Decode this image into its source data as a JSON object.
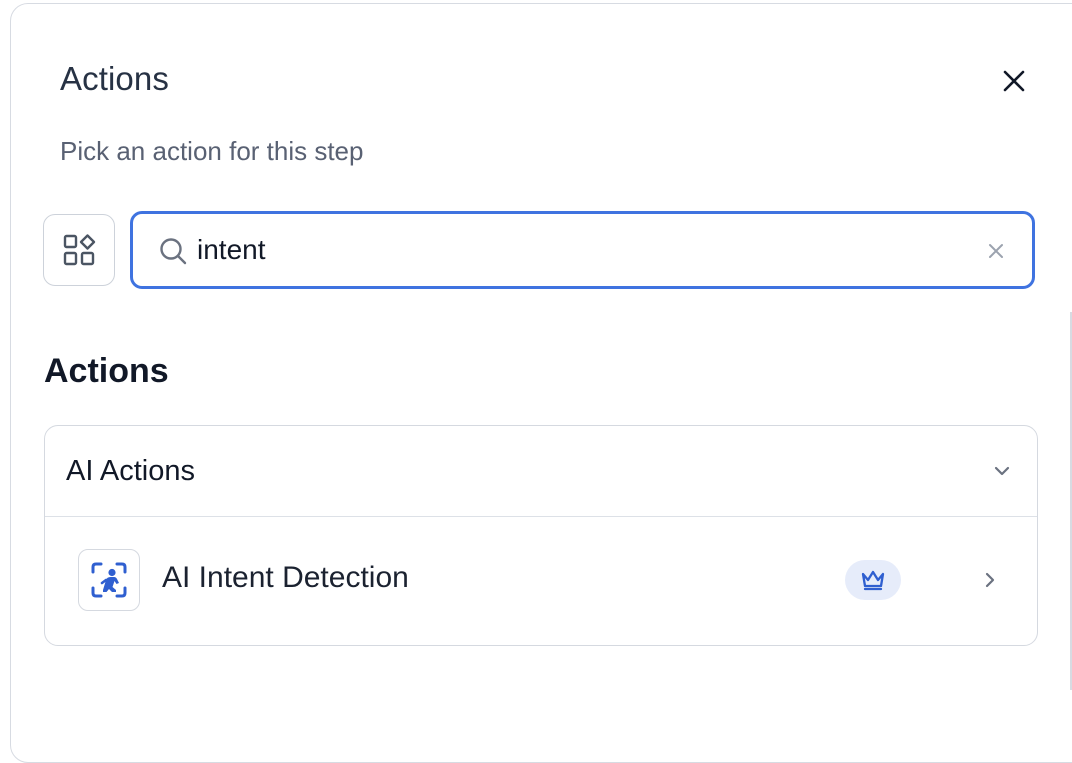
{
  "dialog": {
    "title": "Actions",
    "subtitle": "Pick an action for this step"
  },
  "search": {
    "value": "intent",
    "placeholder": ""
  },
  "section": {
    "heading": "Actions"
  },
  "groups": [
    {
      "title": "AI Actions",
      "expanded": true,
      "items": [
        {
          "label": "AI Intent Detection",
          "icon": "ai-intent-detection-icon",
          "premium": true
        }
      ]
    }
  ],
  "icons": {
    "close": "close-icon",
    "apps": "apps-grid-icon",
    "search": "search-icon",
    "clear": "clear-icon",
    "chevron_down": "chevron-down-icon",
    "chevron_right": "chevron-right-icon",
    "premium": "crown-icon"
  },
  "colors": {
    "accent": "#3f73e0",
    "action_icon": "#2f5fd0",
    "premium_bg": "#e6ecfa"
  }
}
